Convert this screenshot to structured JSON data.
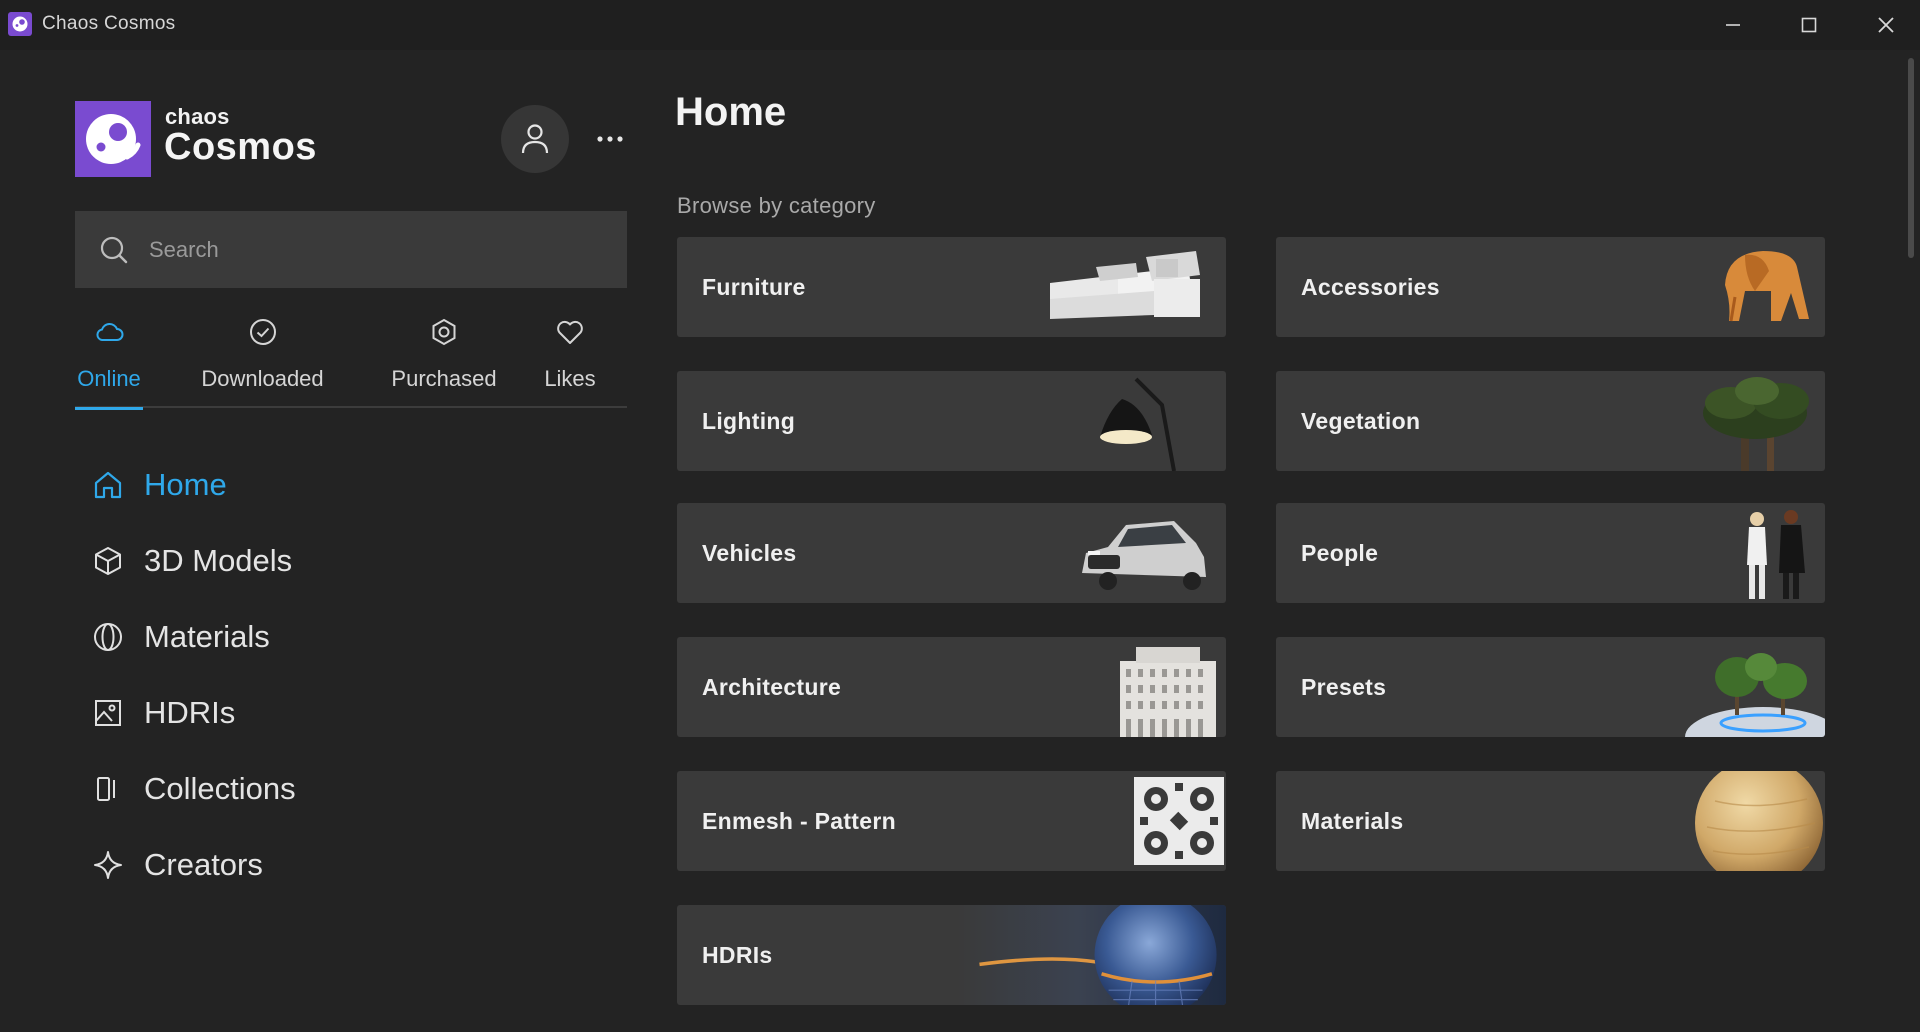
{
  "window": {
    "title": "Chaos Cosmos",
    "icons": {
      "minimize": "minimize-icon",
      "maximize": "maximize-icon",
      "close": "close-icon"
    }
  },
  "sidebar": {
    "brand": {
      "small": "chaos",
      "big": "Cosmos"
    },
    "account_icon": "user-icon",
    "more_icon": "more-dots-icon",
    "search": {
      "placeholder": "Search",
      "value": ""
    },
    "filter_tabs": [
      {
        "label": "Online",
        "icon": "cloud-icon",
        "active": true
      },
      {
        "label": "Downloaded",
        "icon": "check-circle-icon",
        "active": false
      },
      {
        "label": "Purchased",
        "icon": "hexagon-icon",
        "active": false
      },
      {
        "label": "Likes",
        "icon": "heart-icon",
        "active": false
      }
    ],
    "nav": [
      {
        "label": "Home",
        "icon": "home-icon",
        "active": true
      },
      {
        "label": "3D Models",
        "icon": "cube-icon",
        "active": false
      },
      {
        "label": "Materials",
        "icon": "sphere-icon",
        "active": false
      },
      {
        "label": "HDRIs",
        "icon": "image-icon",
        "active": false
      },
      {
        "label": "Collections",
        "icon": "collection-icon",
        "active": false
      },
      {
        "label": "Creators",
        "icon": "sparkle-icon",
        "active": false
      }
    ]
  },
  "main": {
    "title": "Home",
    "section_label": "Browse by category",
    "categories": [
      {
        "label": "Furniture",
        "thumbnail": "sofa"
      },
      {
        "label": "Accessories",
        "thumbnail": "wooden-elephant"
      },
      {
        "label": "Lighting",
        "thumbnail": "desk-lamp"
      },
      {
        "label": "Vegetation",
        "thumbnail": "palm-tree"
      },
      {
        "label": "Vehicles",
        "thumbnail": "car"
      },
      {
        "label": "People",
        "thumbnail": "two-people"
      },
      {
        "label": "Architecture",
        "thumbnail": "building"
      },
      {
        "label": "Presets",
        "thumbnail": "tree-preset"
      },
      {
        "label": "Enmesh - Pattern",
        "thumbnail": "lattice-pattern"
      },
      {
        "label": "Materials",
        "thumbnail": "wood-sphere"
      },
      {
        "label": "HDRIs",
        "thumbnail": "sky-sphere"
      }
    ]
  },
  "colors": {
    "background": "#232323",
    "titlebar": "#1f1f1f",
    "card": "#3a3a3a",
    "accent": "#2fa8ea",
    "brand": "#7a4bd0"
  }
}
